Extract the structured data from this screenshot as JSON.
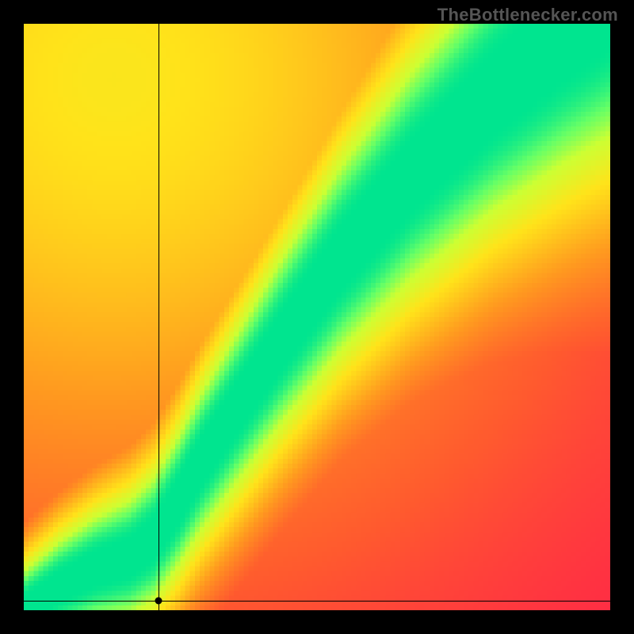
{
  "attribution": "TheBottlenecker.com",
  "chart_data": {
    "type": "heatmap",
    "title": "",
    "xlabel": "",
    "ylabel": "",
    "xlim": [
      0,
      100
    ],
    "ylim": [
      0,
      100
    ],
    "marker": {
      "x": 23,
      "y": 0.5
    },
    "colorscale": [
      {
        "stop": 0.0,
        "color": "#ff1e4b"
      },
      {
        "stop": 0.2,
        "color": "#ff5a2e"
      },
      {
        "stop": 0.45,
        "color": "#ff9a1f"
      },
      {
        "stop": 0.7,
        "color": "#ffe31a"
      },
      {
        "stop": 0.85,
        "color": "#ccff33"
      },
      {
        "stop": 0.93,
        "color": "#66ff66"
      },
      {
        "stop": 1.0,
        "color": "#00e58f"
      }
    ],
    "ridge": {
      "description": "Optimal GPU vs CPU curve. Points (x,y) are normalized 0-100. Color field = 1 on ridge, falls off with distance; extra warm glow from top-left corner.",
      "points": [
        {
          "x": 0,
          "y": 0
        },
        {
          "x": 6,
          "y": 4
        },
        {
          "x": 12,
          "y": 7
        },
        {
          "x": 18,
          "y": 9
        },
        {
          "x": 22,
          "y": 12
        },
        {
          "x": 26,
          "y": 18
        },
        {
          "x": 30,
          "y": 25
        },
        {
          "x": 36,
          "y": 34
        },
        {
          "x": 44,
          "y": 46
        },
        {
          "x": 54,
          "y": 60
        },
        {
          "x": 66,
          "y": 74
        },
        {
          "x": 80,
          "y": 88
        },
        {
          "x": 92,
          "y": 98
        },
        {
          "x": 100,
          "y": 104
        }
      ],
      "half_width_base": 2.0,
      "half_width_scale": 0.055,
      "glow_strength": 0.78
    }
  }
}
